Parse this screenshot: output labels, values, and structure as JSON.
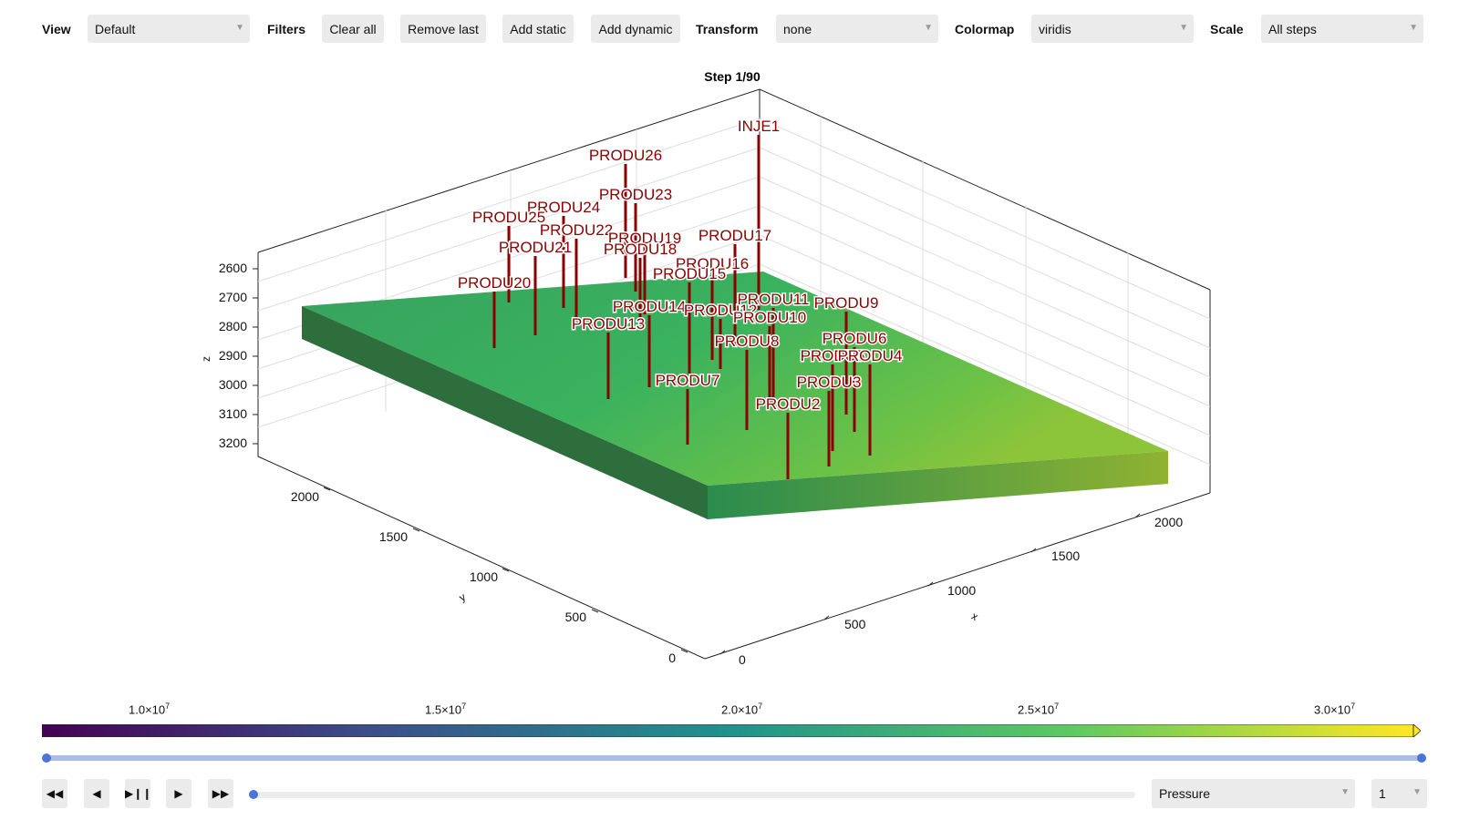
{
  "toolbar": {
    "view_label": "View",
    "view_value": "Default",
    "filters_label": "Filters",
    "clear_all": "Clear all",
    "remove_last": "Remove last",
    "add_static": "Add static",
    "add_dynamic": "Add dynamic",
    "transform_label": "Transform",
    "transform_value": "none",
    "colormap_label": "Colormap",
    "colormap_value": "viridis",
    "scale_label": "Scale",
    "scale_value": "All steps"
  },
  "plot": {
    "title": "Step 1/90",
    "z_label": "z",
    "y_label": "y",
    "x_label": "x",
    "z_ticks": [
      "2600",
      "2700",
      "2800",
      "2900",
      "3000",
      "3100",
      "3200"
    ],
    "y_ticks": [
      "2000",
      "1500",
      "1000",
      "500",
      "0"
    ],
    "x_ticks": [
      "0",
      "500",
      "1000",
      "1500",
      "2000"
    ],
    "wells": [
      "INJE1",
      "PRODU26",
      "PRODU23",
      "PRODU24",
      "PRODU25",
      "PRODU22",
      "PRODU21",
      "PRODU19",
      "PRODU18",
      "PRODU17",
      "PRODU16",
      "PRODU15",
      "PRODU20",
      "PRODU14",
      "PRODU12",
      "PRODU11",
      "PRODU9",
      "PRODU13",
      "PRODU10",
      "PRODU8",
      "PRODU6",
      "PRODU5",
      "PRODU4",
      "PRODU7",
      "PRODU3",
      "PRODU2"
    ],
    "well_color": "#8b0000"
  },
  "colorbar": {
    "ticks": [
      "1.0×10",
      "1.5×10",
      "2.0×10",
      "2.5×10",
      "3.0×10"
    ],
    "exponent": "7",
    "colors": [
      "#440154",
      "#3b528b",
      "#21918c",
      "#5ec962",
      "#fde725"
    ]
  },
  "controls": {
    "variable": "Pressure",
    "step_select": "1",
    "step_slider_value": 1
  }
}
